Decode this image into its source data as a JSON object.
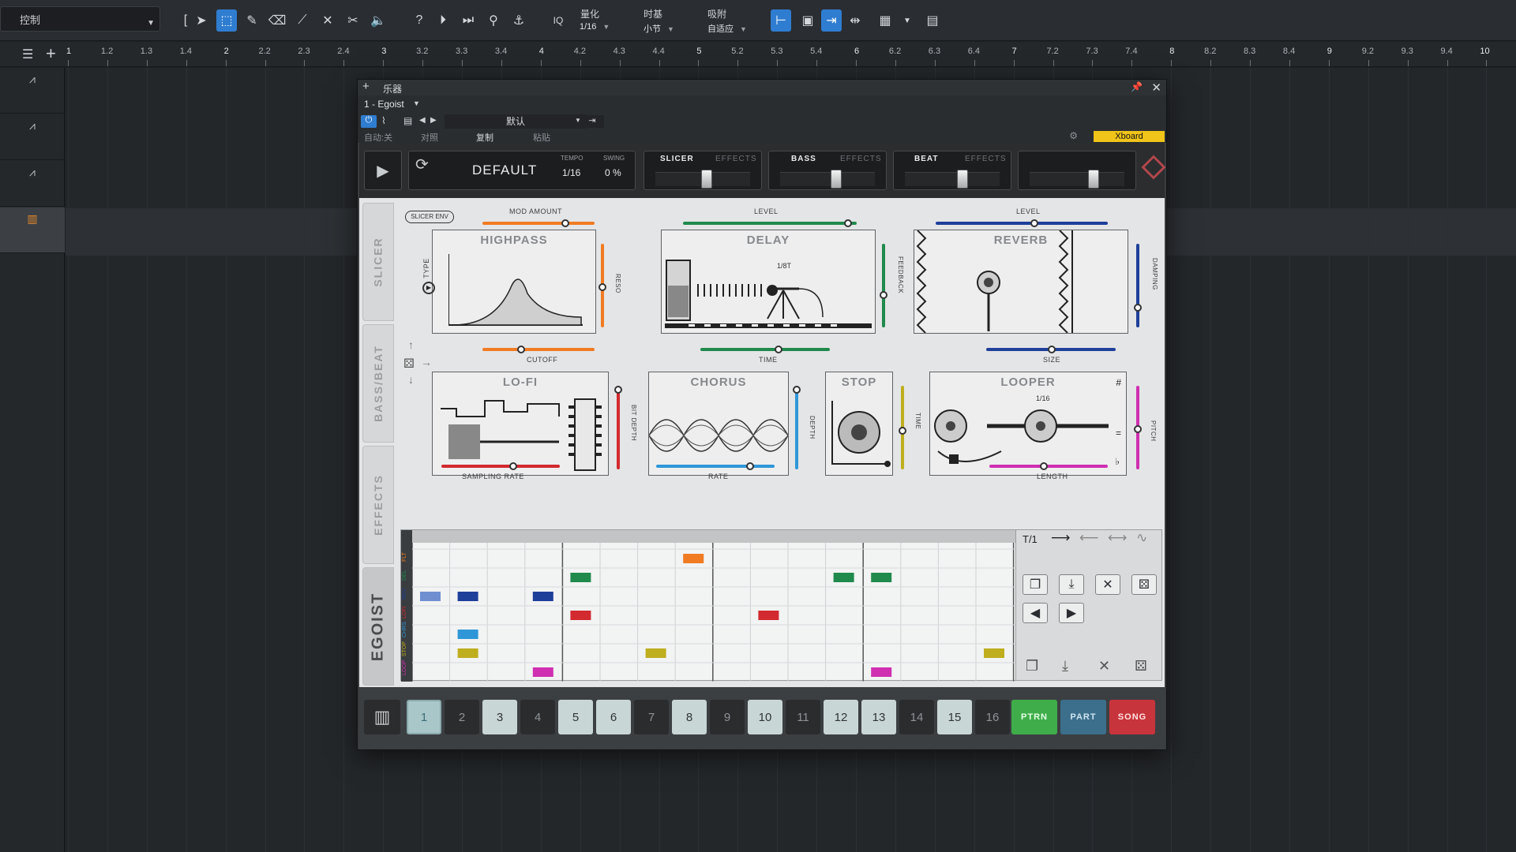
{
  "toolbar": {
    "control_label": "控制",
    "quantize_label": "量化",
    "quantize_value": "1/16",
    "timebase_label": "时基",
    "timebase_value": "小节",
    "snap_label": "吸附",
    "snap_value": "自适应",
    "iq_label": "IQ"
  },
  "ruler": {
    "ticks": [
      "1",
      "1.2",
      "1.3",
      "1.4",
      "2",
      "2.2",
      "2.3",
      "2.4",
      "3",
      "3.2",
      "3.3",
      "3.4",
      "4",
      "4.2",
      "4.3",
      "4.4",
      "5",
      "5.2",
      "5.3",
      "5.4",
      "6",
      "6.2",
      "6.3",
      "6.4",
      "7",
      "7.2",
      "7.3",
      "7.4",
      "8",
      "8.2",
      "8.3",
      "8.4",
      "9",
      "9.2",
      "9.3",
      "9.4",
      "10"
    ]
  },
  "plugin": {
    "window_title": "乐器",
    "instance": "1 - Egoist",
    "preset": "默认",
    "row4": {
      "auto": "自动:关",
      "compare": "对照",
      "copy": "复制",
      "paste": "粘贴"
    },
    "xboard": "Xboard"
  },
  "egoist": {
    "preset_name": "DEFAULT",
    "tempo_label": "TEMPO",
    "tempo_value": "1/16",
    "swing_label": "SWING",
    "swing_value": "0 %",
    "sections": [
      {
        "name": "SLICER",
        "effects": "EFFECTS",
        "fader": 0.55
      },
      {
        "name": "BASS",
        "effects": "EFFECTS",
        "fader": 0.6
      },
      {
        "name": "BEAT",
        "effects": "EFFECTS",
        "fader": 0.62
      }
    ],
    "master_fader": 0.7,
    "side_tabs": [
      "SLICER",
      "BASS/BEAT",
      "EFFECTS",
      "EGOIST"
    ],
    "fx": {
      "slicer_env": "SLICER ENV",
      "mod_amount": "MOD AMOUNT",
      "highpass": "HIGHPASS",
      "type": "TYPE",
      "reso": "RESO",
      "cutoff": "CUTOFF",
      "delay": "DELAY",
      "delay_time_value": "1/8T",
      "level": "LEVEL",
      "feedback": "FEEDBACK",
      "time": "TIME",
      "reverb": "REVERB",
      "damping": "DAMPING",
      "size": "SIZE",
      "lofi": "LO-FI",
      "bit_depth": "BIT DEPTH",
      "sampling_rate": "SAMPLING RATE",
      "chorus": "CHORUS",
      "depth": "DEPTH",
      "rate": "RATE",
      "stop": "STOP",
      "stop_time": "TIME",
      "looper": "LOOPER",
      "looper_value": "1/16",
      "pitch": "PITCH",
      "length": "LENGTH"
    },
    "sequencer": {
      "rows": [
        "FLT",
        "DEL",
        "REV",
        "LOFI",
        "CHRS",
        "STOP",
        "LOOP"
      ],
      "length_label": "T/1",
      "colors": {
        "FLT": "#f07b22",
        "DEL": "#1f8a4c",
        "REV": "#1e3f9a",
        "LOFI": "#d22a2f",
        "CHRS": "#2f97d8",
        "STOP": "#bfae1e",
        "LOOP": "#cf2fb0"
      }
    },
    "pads": [
      "1",
      "2",
      "3",
      "4",
      "5",
      "6",
      "7",
      "8",
      "9",
      "10",
      "11",
      "12",
      "13",
      "14",
      "15",
      "16"
    ],
    "modes": {
      "ptrn": "PTRN",
      "part": "PART",
      "song": "SONG"
    }
  },
  "colors": {
    "accent": "#2f7dd1",
    "ptrn": "#3fae4a",
    "part": "#3c6f8c",
    "song": "#c8343b"
  }
}
